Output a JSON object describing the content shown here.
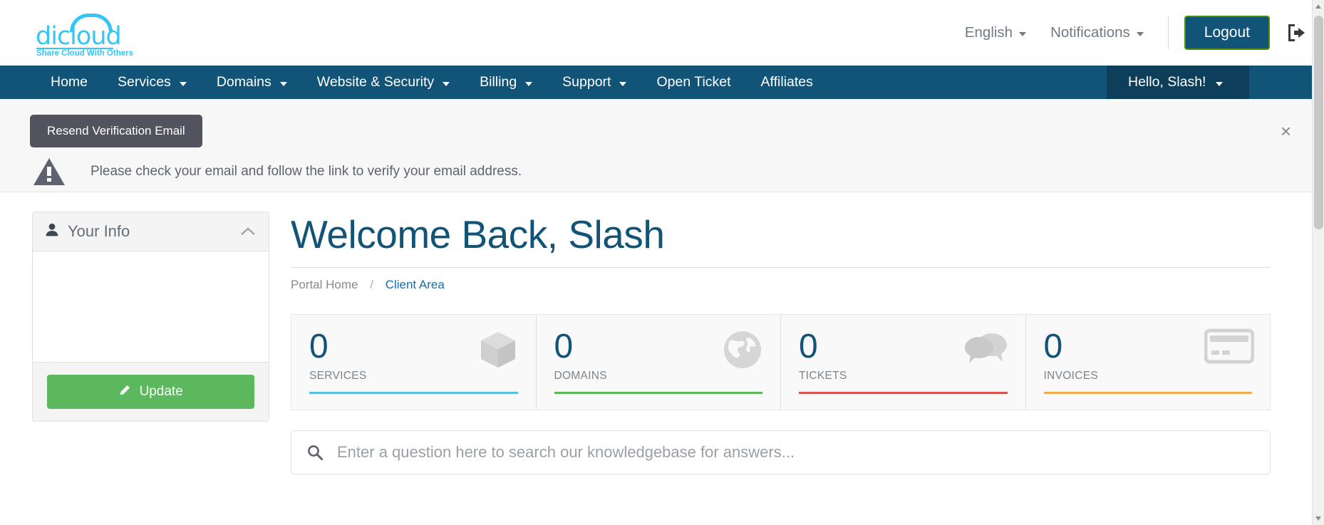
{
  "brand": {
    "name": "dicloud",
    "tagline": "Share Cloud With Others",
    "color": "#35c6f4"
  },
  "topbar": {
    "language": "English",
    "notifications": "Notifications",
    "logout_label": "Logout",
    "logout_bg": "#125478",
    "logout_border": "#4a8f0c",
    "signout_icon": "sign-out-icon"
  },
  "nav": {
    "bg": "#125478",
    "user_bg": "#0d3f5a",
    "items": [
      {
        "label": "Home",
        "caret": false
      },
      {
        "label": "Services",
        "caret": true
      },
      {
        "label": "Domains",
        "caret": true
      },
      {
        "label": "Website & Security",
        "caret": true
      },
      {
        "label": "Billing",
        "caret": true
      },
      {
        "label": "Support",
        "caret": true
      },
      {
        "label": "Open Ticket",
        "caret": false
      },
      {
        "label": "Affiliates",
        "caret": false
      }
    ],
    "user_label": "Hello, Slash!"
  },
  "alert": {
    "button_label": "Resend Verification Email",
    "button_bg": "#53535f",
    "message": "Please check your email and follow the link to verify your email address.",
    "close_label": "×",
    "icon": "warning-triangle-icon"
  },
  "sidebar": {
    "panel_title": "Your Info",
    "panel_icon": "user-icon",
    "collapse_icon": "chevron-up-icon",
    "update_label": "Update",
    "update_bg": "#5cb85c",
    "update_icon": "pencil-icon"
  },
  "main": {
    "heading": "Welcome Back, Slash",
    "heading_color": "#125478",
    "breadcrumb": [
      {
        "label": "Portal Home",
        "active": false
      },
      {
        "label": "Client Area",
        "active": true
      }
    ],
    "breadcrumb_separator": "/",
    "stats": [
      {
        "value": "0",
        "label": "SERVICES",
        "bar_color": "#5bc0de",
        "icon": "box-icon"
      },
      {
        "value": "0",
        "label": "DOMAINS",
        "bar_color": "#5cb85c",
        "icon": "globe-icon"
      },
      {
        "value": "0",
        "label": "TICKETS",
        "bar_color": "#d9534f",
        "icon": "comments-icon"
      },
      {
        "value": "0",
        "label": "INVOICES",
        "bar_color": "#f0ad4e",
        "icon": "credit-card-icon"
      }
    ],
    "search": {
      "placeholder": "Enter a question here to search our knowledgebase for answers...",
      "value": "",
      "icon": "search-icon"
    }
  }
}
